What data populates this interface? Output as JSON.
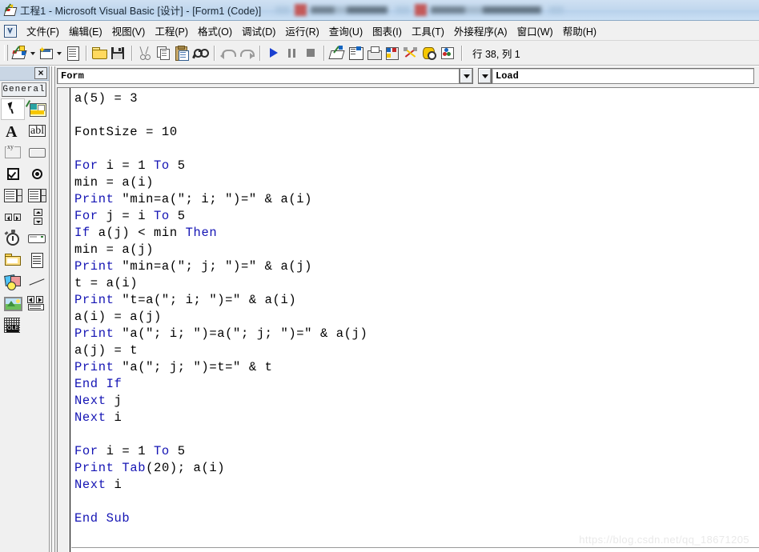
{
  "window": {
    "title": "工程1 - Microsoft Visual Basic [设计] - [Form1 (Code)]",
    "app_icon": "vb-project-icon"
  },
  "taskbar_blurred": {
    "note_hidden": true
  },
  "menubar": {
    "items": [
      {
        "label": "文件(F)",
        "name": "menu-file"
      },
      {
        "label": "编辑(E)",
        "name": "menu-edit"
      },
      {
        "label": "视图(V)",
        "name": "menu-view"
      },
      {
        "label": "工程(P)",
        "name": "menu-project"
      },
      {
        "label": "格式(O)",
        "name": "menu-format"
      },
      {
        "label": "调试(D)",
        "name": "menu-debug"
      },
      {
        "label": "运行(R)",
        "name": "menu-run"
      },
      {
        "label": "查询(U)",
        "name": "menu-query"
      },
      {
        "label": "图表(I)",
        "name": "menu-diagram"
      },
      {
        "label": "工具(T)",
        "name": "menu-tools"
      },
      {
        "label": "外接程序(A)",
        "name": "menu-addins"
      },
      {
        "label": "窗口(W)",
        "name": "menu-window"
      },
      {
        "label": "帮助(H)",
        "name": "menu-help"
      }
    ]
  },
  "toolbar": {
    "status_position": "行 38, 列 1",
    "buttons": [
      "add-project-icon",
      "add-form-icon",
      "menu-editor-icon",
      "open-project-icon",
      "save-project-icon",
      "cut-icon",
      "copy-icon",
      "paste-icon",
      "find-icon",
      "undo-icon",
      "redo-icon",
      "start-run-icon",
      "break-pause-icon",
      "end-stop-icon",
      "project-explorer-icon",
      "properties-window-icon",
      "form-layout-icon",
      "object-browser-icon",
      "toolbox-icon",
      "data-view-icon",
      "component-manager-icon"
    ]
  },
  "toolbox": {
    "close_label": "×",
    "tab_label": "General",
    "tools": [
      {
        "name": "pointer-tool",
        "icon": "pointer-icon"
      },
      {
        "name": "picturebox-tool",
        "icon": "picturebox-icon"
      },
      {
        "name": "label-tool",
        "icon": "label-A-icon"
      },
      {
        "name": "textbox-tool",
        "icon": "textbox-abl-icon"
      },
      {
        "name": "frame-tool",
        "icon": "frame-xy-icon"
      },
      {
        "name": "commandbutton-tool",
        "icon": "command-button-icon"
      },
      {
        "name": "checkbox-tool",
        "icon": "checkbox-icon"
      },
      {
        "name": "optionbutton-tool",
        "icon": "option-button-icon"
      },
      {
        "name": "combobox-tool",
        "icon": "combobox-icon"
      },
      {
        "name": "listbox-tool",
        "icon": "listbox-icon"
      },
      {
        "name": "hscrollbar-tool",
        "icon": "hscrollbar-icon"
      },
      {
        "name": "vscrollbar-tool",
        "icon": "vscrollbar-icon"
      },
      {
        "name": "timer-tool",
        "icon": "timer-stopwatch-icon"
      },
      {
        "name": "drivelistbox-tool",
        "icon": "drive-listbox-icon"
      },
      {
        "name": "dirlistbox-tool",
        "icon": "dir-listbox-folder-icon"
      },
      {
        "name": "filelistbox-tool",
        "icon": "file-listbox-icon"
      },
      {
        "name": "shape-tool",
        "icon": "shape-icon"
      },
      {
        "name": "line-tool",
        "icon": "line-icon"
      },
      {
        "name": "image-tool",
        "icon": "image-icon"
      },
      {
        "name": "data-tool",
        "icon": "data-control-icon"
      },
      {
        "name": "ole-tool",
        "icon": "ole-container-icon"
      }
    ],
    "selected_index": 0
  },
  "code_window": {
    "object_dropdown": "Form",
    "procedure_dropdown": "Load",
    "lines": [
      {
        "segs": [
          {
            "t": "a(5) = 3",
            "c": "plain"
          }
        ]
      },
      {
        "segs": []
      },
      {
        "segs": [
          {
            "t": "FontSize = 10",
            "c": "plain"
          }
        ]
      },
      {
        "segs": []
      },
      {
        "segs": [
          {
            "t": "For",
            "c": "kw"
          },
          {
            "t": " i = 1 ",
            "c": "plain"
          },
          {
            "t": "To",
            "c": "kw"
          },
          {
            "t": " 5",
            "c": "plain"
          }
        ]
      },
      {
        "segs": [
          {
            "t": "min = a(i)",
            "c": "plain"
          }
        ]
      },
      {
        "segs": [
          {
            "t": "Print",
            "c": "kw"
          },
          {
            "t": " ″min=a(″; i; ″)=″ & a(i)",
            "c": "plain"
          }
        ]
      },
      {
        "segs": [
          {
            "t": "For",
            "c": "kw"
          },
          {
            "t": " j = i ",
            "c": "plain"
          },
          {
            "t": "To",
            "c": "kw"
          },
          {
            "t": " 5",
            "c": "plain"
          }
        ]
      },
      {
        "segs": [
          {
            "t": "If",
            "c": "kw"
          },
          {
            "t": " a(j) < min ",
            "c": "plain"
          },
          {
            "t": "Then",
            "c": "kw"
          }
        ]
      },
      {
        "segs": [
          {
            "t": "min = a(j)",
            "c": "plain"
          }
        ]
      },
      {
        "segs": [
          {
            "t": "Print",
            "c": "kw"
          },
          {
            "t": " ″min=a(″; j; ″)=″ & a(j)",
            "c": "plain"
          }
        ]
      },
      {
        "segs": [
          {
            "t": "t = a(i)",
            "c": "plain"
          }
        ]
      },
      {
        "segs": [
          {
            "t": "Print",
            "c": "kw"
          },
          {
            "t": " ″t=a(″; i; ″)=″ & a(i)",
            "c": "plain"
          }
        ]
      },
      {
        "segs": [
          {
            "t": "a(i) = a(j)",
            "c": "plain"
          }
        ]
      },
      {
        "segs": [
          {
            "t": "Print",
            "c": "kw"
          },
          {
            "t": " ″a(″; i; ″)=a(″; j; ″)=″ & a(j)",
            "c": "plain"
          }
        ]
      },
      {
        "segs": [
          {
            "t": "a(j) = t",
            "c": "plain"
          }
        ]
      },
      {
        "segs": [
          {
            "t": "Print",
            "c": "kw"
          },
          {
            "t": " ″a(″; j; ″)=t=″ & t",
            "c": "plain"
          }
        ]
      },
      {
        "segs": [
          {
            "t": "End If",
            "c": "kw"
          }
        ]
      },
      {
        "segs": [
          {
            "t": "Next",
            "c": "kw"
          },
          {
            "t": " j",
            "c": "plain"
          }
        ]
      },
      {
        "segs": [
          {
            "t": "Next",
            "c": "kw"
          },
          {
            "t": " i",
            "c": "plain"
          }
        ]
      },
      {
        "segs": []
      },
      {
        "segs": [
          {
            "t": "For",
            "c": "kw"
          },
          {
            "t": " i = 1 ",
            "c": "plain"
          },
          {
            "t": "To",
            "c": "kw"
          },
          {
            "t": " 5",
            "c": "plain"
          }
        ]
      },
      {
        "segs": [
          {
            "t": "Print",
            "c": "kw"
          },
          {
            "t": " ",
            "c": "plain"
          },
          {
            "t": "Tab",
            "c": "kw"
          },
          {
            "t": "(20); a(i)",
            "c": "plain"
          }
        ]
      },
      {
        "segs": [
          {
            "t": "Next",
            "c": "kw"
          },
          {
            "t": " i",
            "c": "plain"
          }
        ]
      },
      {
        "segs": []
      },
      {
        "segs": [
          {
            "t": "End Sub",
            "c": "kw"
          }
        ]
      }
    ]
  },
  "watermark": {
    "text": "https://blog.csdn.net/qq_18671205"
  },
  "colors": {
    "keyword_blue": "#1414b4",
    "code_black": "#000000",
    "titlebar_blue": "#c2d8ee",
    "chrome_gray": "#f0f0f0"
  }
}
